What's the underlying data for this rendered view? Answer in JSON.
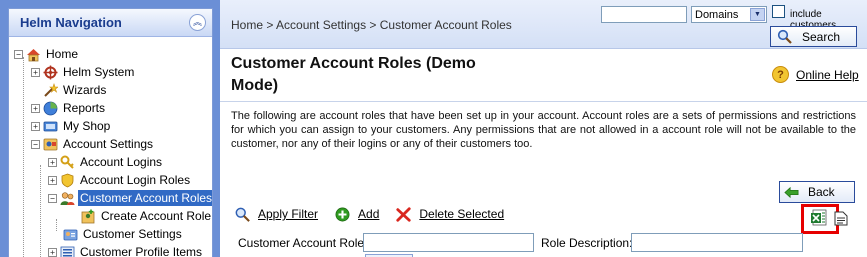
{
  "sidebar": {
    "title": "Helm Navigation",
    "collapse_icon": "double-chevron-up-icon",
    "items": [
      {
        "label": "Home",
        "icon": "home-icon",
        "expander": "−"
      },
      {
        "label": "Helm System",
        "icon": "helm-wheel-icon",
        "expander": "+"
      },
      {
        "label": "Wizards",
        "icon": "wand-icon",
        "expander": ""
      },
      {
        "label": "Reports",
        "icon": "reports-icon",
        "expander": "+"
      },
      {
        "label": "My Shop",
        "icon": "shop-icon",
        "expander": "+"
      },
      {
        "label": "Account Settings",
        "icon": "account-settings-icon",
        "expander": "−"
      },
      {
        "label": "Account Logins",
        "icon": "keys-icon",
        "expander": "+"
      },
      {
        "label": "Account Login Roles",
        "icon": "shield-icon",
        "expander": "+"
      },
      {
        "label": "Customer Account Roles",
        "icon": "users-icon",
        "expander": "−",
        "selected": true
      },
      {
        "label": "Create Account Role",
        "icon": "add-user-icon",
        "expander": ""
      },
      {
        "label": "Customer Settings",
        "icon": "customer-settings-icon",
        "expander": ""
      },
      {
        "label": "Customer Profile Items",
        "icon": "profile-items-icon",
        "expander": "+"
      }
    ]
  },
  "topbar": {
    "breadcrumb": "Home > Account Settings > Customer Account Roles",
    "search_value": "",
    "domains_select": "Domains",
    "include_customers_label": "include customers.",
    "search_button": "Search"
  },
  "page": {
    "title": "Customer Account Roles (Demo Mode)",
    "online_help": "Online Help",
    "description": "The following are account roles that have been set up in your account. Account roles are a sets of permissions and restrictions for which you can assign to your customers. Any permissions that are not allowed in a account role will not be available to the customer, nor any of their logins or any of their customers too.",
    "back_button": "Back"
  },
  "toolbar": {
    "apply_filter": "Apply Filter",
    "add": "Add",
    "delete_selected": "Delete Selected"
  },
  "filters": {
    "customer_account_role_label": "Customer Account Role:",
    "customer_account_role_value": "",
    "role_description_label": "Role Description:",
    "role_description_value": ""
  },
  "colors": {
    "sidebar_bg": "#6b8fd6",
    "selected_bg": "#316ac5",
    "highlight": "#e60000",
    "title_color": "#1a3c8e"
  }
}
